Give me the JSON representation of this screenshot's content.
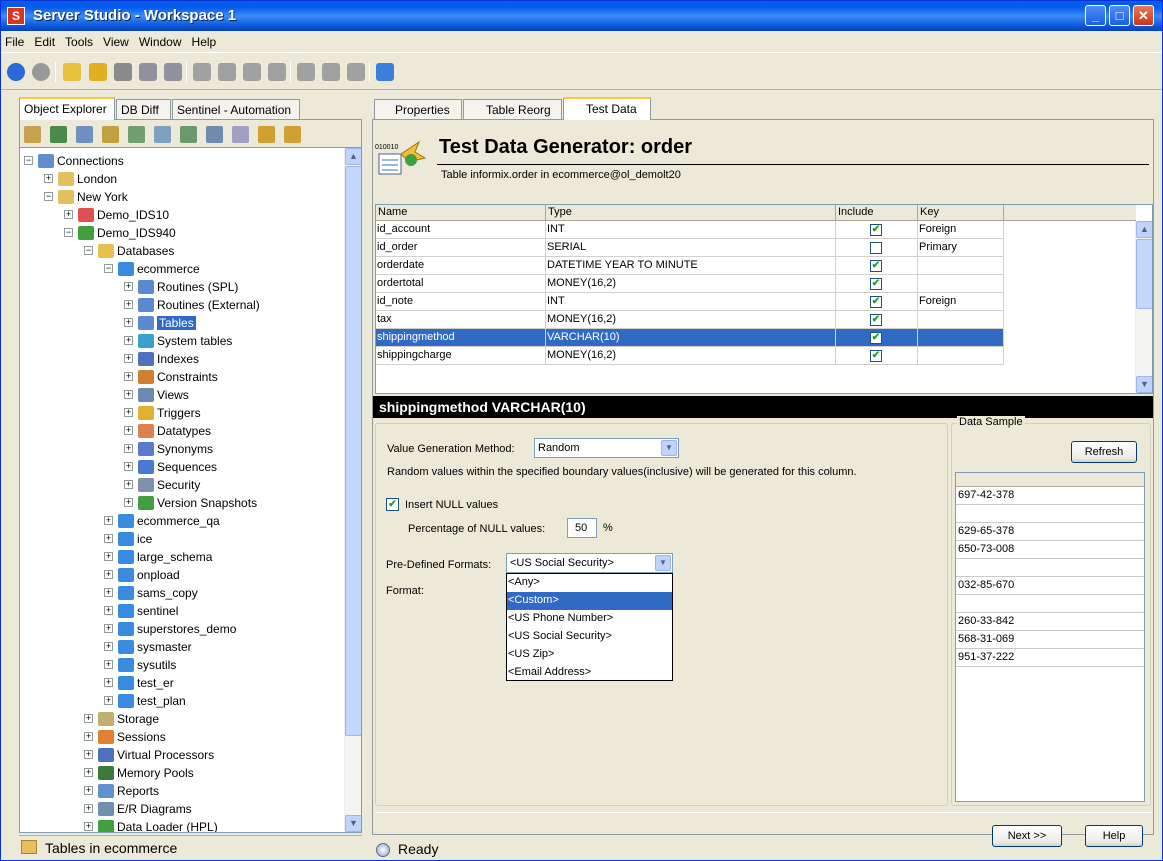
{
  "window": {
    "title": "Server Studio - Workspace 1",
    "app_icon": "S"
  },
  "menu": [
    "File",
    "Edit",
    "Tools",
    "View",
    "Window",
    "Help"
  ],
  "toolbar_icons": [
    "back-icon",
    "stop-icon",
    "open-icon",
    "upload-icon",
    "print-icon",
    "save-icon",
    "save-as-icon",
    "undo-icon",
    "copy-icon",
    "paste-icon",
    "cut-icon",
    "arrow-icon",
    "connect-icon",
    "tools-icon",
    "refresh-icon"
  ],
  "left": {
    "tabs": [
      "Object Explorer",
      "DB Diff",
      "Sentinel - Automation"
    ],
    "status": "Tables in ecommerce",
    "tree": [
      {
        "label": "Connections",
        "exp": "−"
      },
      {
        "label": "London",
        "exp": "+"
      },
      {
        "label": "New York",
        "exp": "−"
      },
      {
        "label": "Demo_IDS10",
        "exp": "+"
      },
      {
        "label": "Demo_IDS940",
        "exp": "−"
      },
      {
        "label": "Databases",
        "exp": "−"
      },
      {
        "label": "ecommerce",
        "exp": "−"
      },
      {
        "label": "Routines (SPL)",
        "exp": "+"
      },
      {
        "label": "Routines (External)",
        "exp": "+"
      },
      {
        "label": "Tables",
        "exp": "+"
      },
      {
        "label": "System tables",
        "exp": "+"
      },
      {
        "label": "Indexes",
        "exp": "+"
      },
      {
        "label": "Constraints",
        "exp": "+"
      },
      {
        "label": "Views",
        "exp": "+"
      },
      {
        "label": "Triggers",
        "exp": "+"
      },
      {
        "label": "Datatypes",
        "exp": "+"
      },
      {
        "label": "Synonyms",
        "exp": "+"
      },
      {
        "label": "Sequences",
        "exp": "+"
      },
      {
        "label": "Security",
        "exp": "+"
      },
      {
        "label": "Version Snapshots",
        "exp": "+"
      },
      {
        "label": "ecommerce_qa",
        "exp": "+"
      },
      {
        "label": "ice",
        "exp": "+"
      },
      {
        "label": "large_schema",
        "exp": "+"
      },
      {
        "label": "onpload",
        "exp": "+"
      },
      {
        "label": "sams_copy",
        "exp": "+"
      },
      {
        "label": "sentinel",
        "exp": "+"
      },
      {
        "label": "superstores_demo",
        "exp": "+"
      },
      {
        "label": "sysmaster",
        "exp": "+"
      },
      {
        "label": "sysutils",
        "exp": "+"
      },
      {
        "label": "test_er",
        "exp": "+"
      },
      {
        "label": "test_plan",
        "exp": "+"
      },
      {
        "label": "Storage",
        "exp": "+"
      },
      {
        "label": "Sessions",
        "exp": "+"
      },
      {
        "label": "Virtual Processors",
        "exp": "+"
      },
      {
        "label": "Memory Pools",
        "exp": "+"
      },
      {
        "label": "Reports",
        "exp": "+"
      },
      {
        "label": "E/R Diagrams",
        "exp": "+"
      },
      {
        "label": "Data Loader (HPL)",
        "exp": "+"
      }
    ]
  },
  "right": {
    "tabs": [
      "Properties",
      "Table Reorg",
      "Test Data"
    ],
    "title": "Test Data Generator: order",
    "subtitle": "Table informix.order in ecommerce@ol_demolt20",
    "icon_text": "010010",
    "columns": [
      "Name",
      "Type",
      "Include",
      "Key"
    ],
    "rows": [
      {
        "name": "id_account",
        "type": "INT",
        "include": true,
        "key": "Foreign"
      },
      {
        "name": "id_order",
        "type": "SERIAL",
        "include": false,
        "key": "Primary"
      },
      {
        "name": "orderdate",
        "type": "DATETIME YEAR TO MINUTE",
        "include": true,
        "key": ""
      },
      {
        "name": "ordertotal",
        "type": "MONEY(16,2)",
        "include": true,
        "key": ""
      },
      {
        "name": "id_note",
        "type": "INT",
        "include": true,
        "key": "Foreign"
      },
      {
        "name": "tax",
        "type": "MONEY(16,2)",
        "include": true,
        "key": ""
      },
      {
        "name": "shippingmethod",
        "type": "VARCHAR(10)",
        "include": true,
        "key": ""
      },
      {
        "name": "shippingcharge",
        "type": "MONEY(16,2)",
        "include": true,
        "key": ""
      }
    ],
    "section_title": "shippingmethod VARCHAR(10)",
    "value_method_label": "Value Generation Method:",
    "value_method": "Random",
    "random_desc": "Random values within the specified boundary values(inclusive) will be generated for this column.",
    "insert_null_label": "Insert NULL values",
    "null_pct_label": "Percentage of NULL values:",
    "null_pct": "50",
    "pct_sign": "%",
    "predefined_label": "Pre-Defined Formats:",
    "predefined_value": "<US Social Security>",
    "format_label": "Format:",
    "format_options": [
      "<Any>",
      "<Custom>",
      "<US Phone Number>",
      "<US Social Security>",
      "<US Zip>",
      "<Email Address>"
    ],
    "sample_legend": "Data Sample",
    "refresh_label": "Refresh",
    "samples": [
      "697-42-378",
      "",
      "629-65-378",
      "650-73-008",
      "",
      "032-85-670",
      "",
      "260-33-842",
      "568-31-069",
      "951-37-222"
    ],
    "next_label": "Next >>",
    "help_label": "Help",
    "status": "Ready"
  }
}
